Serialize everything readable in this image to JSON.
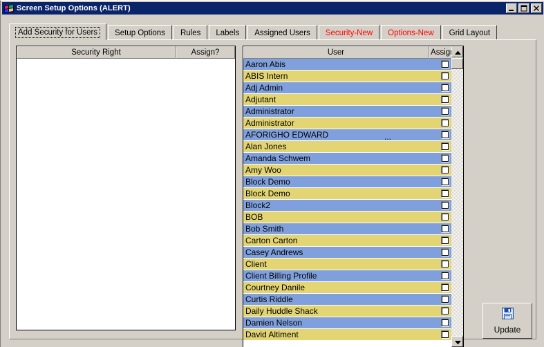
{
  "window": {
    "title": "Screen Setup Options (ALERT)",
    "icon": "windows-flag-icon",
    "titlebar_color": "#0a246a",
    "face_color": "#d4d0c8",
    "controls": [
      {
        "name": "minimize-button",
        "glyph": "minimize-icon"
      },
      {
        "name": "maximize-button",
        "glyph": "maximize-icon"
      },
      {
        "name": "close-button",
        "glyph": "close-icon"
      }
    ]
  },
  "tabs": [
    {
      "label": "Add Security for Users",
      "active": true,
      "red": false
    },
    {
      "label": "Setup Options",
      "active": false,
      "red": false
    },
    {
      "label": "Rules",
      "active": false,
      "red": false
    },
    {
      "label": "Labels",
      "active": false,
      "red": false
    },
    {
      "label": "Assigned Users",
      "active": false,
      "red": false
    },
    {
      "label": "Security-New",
      "active": false,
      "red": true
    },
    {
      "label": "Options-New",
      "active": false,
      "red": true
    },
    {
      "label": "Grid Layout",
      "active": false,
      "red": false
    }
  ],
  "left_grid": {
    "headers": {
      "name": "Security Right",
      "assign": "Assign?"
    },
    "rows": []
  },
  "right_grid": {
    "headers": {
      "name": "User",
      "assign": "Assign?"
    },
    "rows": [
      {
        "name": "Aaron Abis",
        "checked": false,
        "ellipsis": false
      },
      {
        "name": "ABIS Intern",
        "checked": false,
        "ellipsis": false
      },
      {
        "name": "Adj Admin",
        "checked": false,
        "ellipsis": false
      },
      {
        "name": "Adjutant",
        "checked": false,
        "ellipsis": false
      },
      {
        "name": "Administrator",
        "checked": false,
        "ellipsis": false
      },
      {
        "name": "Administrator",
        "checked": false,
        "ellipsis": false
      },
      {
        "name": "AFORIGHO EDWARD",
        "checked": false,
        "ellipsis": true
      },
      {
        "name": "Alan Jones",
        "checked": false,
        "ellipsis": false
      },
      {
        "name": "Amanda Schwem",
        "checked": false,
        "ellipsis": false
      },
      {
        "name": "Amy Woo",
        "checked": false,
        "ellipsis": false
      },
      {
        "name": "Block  Demo",
        "checked": false,
        "ellipsis": false
      },
      {
        "name": "Block  Demo",
        "checked": false,
        "ellipsis": false
      },
      {
        "name": "Block2",
        "checked": false,
        "ellipsis": false
      },
      {
        "name": "BOB",
        "checked": false,
        "ellipsis": false
      },
      {
        "name": "Bob Smith",
        "checked": false,
        "ellipsis": false
      },
      {
        "name": "Carton Carton",
        "checked": false,
        "ellipsis": false
      },
      {
        "name": "Casey Andrews",
        "checked": false,
        "ellipsis": false
      },
      {
        "name": "Client",
        "checked": false,
        "ellipsis": false
      },
      {
        "name": "Client Billing Profile",
        "checked": false,
        "ellipsis": false
      },
      {
        "name": "Courtney Danile",
        "checked": false,
        "ellipsis": false
      },
      {
        "name": "Curtis  Riddle",
        "checked": false,
        "ellipsis": false
      },
      {
        "name": "Daily Huddle Shack",
        "checked": false,
        "ellipsis": false
      },
      {
        "name": "Damien Nelson",
        "checked": false,
        "ellipsis": false
      },
      {
        "name": "David Altiment",
        "checked": false,
        "ellipsis": false
      }
    ],
    "ellipsis_text": "...",
    "row_colors": {
      "even": "#7fa0dc",
      "odd": "#e3d573"
    }
  },
  "scrollbar": {
    "up_arrow": "scroll-up-arrow-icon",
    "down_arrow": "scroll-down-arrow-icon"
  },
  "update_button": {
    "label": "Update",
    "icon": "save-floppy-icon"
  }
}
